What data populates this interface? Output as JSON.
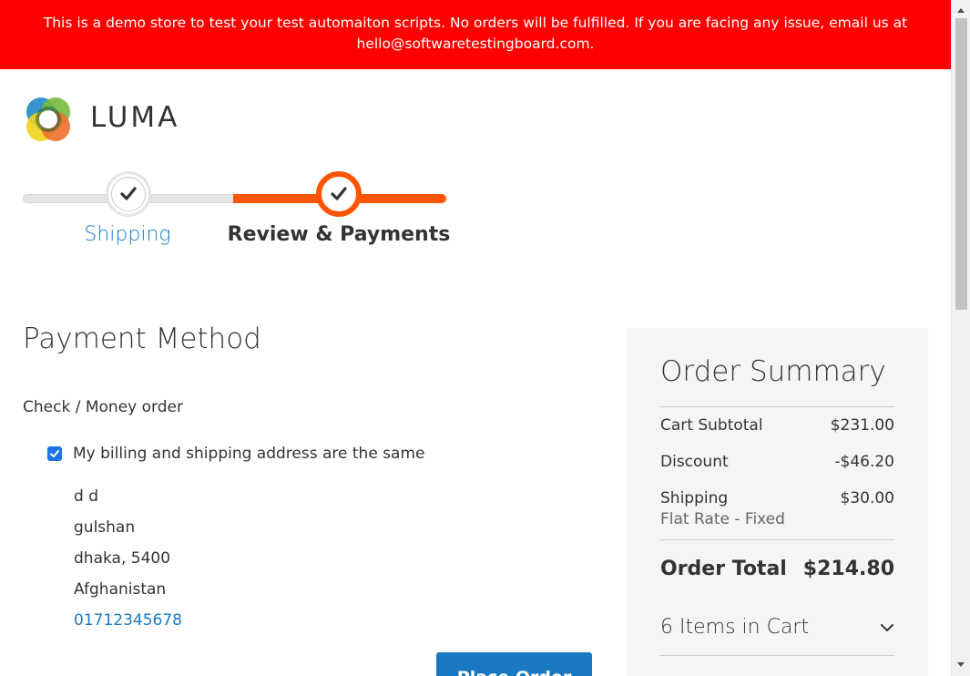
{
  "banner": {
    "text": "This is a demo store to test your test automaiton scripts. No orders will be fulfilled. If you are facing any issue, email us at hello@softwaretestingboard.com."
  },
  "logo": {
    "text": "LUMA",
    "colors": [
      "#2a8fc9",
      "#79b83f",
      "#f2d21b",
      "#ee6f2d",
      "#1a5a3a"
    ]
  },
  "progress": {
    "steps": [
      {
        "label": "Shipping",
        "state": "complete"
      },
      {
        "label": "Review & Payments",
        "state": "active"
      }
    ],
    "accent": "#ff5501"
  },
  "payment": {
    "title": "Payment Method",
    "method_label": "Check / Money order",
    "billing_same_label": "My billing and shipping address are the same",
    "billing_same_checked": true,
    "address": {
      "name": "d d",
      "street": "gulshan",
      "city_zip": "dhaka, 5400",
      "country": "Afghanistan",
      "phone": "01712345678"
    },
    "place_order_label": "Place Order"
  },
  "summary": {
    "title": "Order Summary",
    "subtotal_label": "Cart Subtotal",
    "subtotal_value": "$231.00",
    "discount_label": "Discount",
    "discount_value": "-$46.20",
    "shipping_label": "Shipping",
    "shipping_method": "Flat Rate - Fixed",
    "shipping_value": "$30.00",
    "total_label": "Order Total",
    "total_value": "$214.80",
    "items_label": "6 Items in Cart"
  },
  "colors": {
    "banner_bg": "#ff0000",
    "link": "#1979c3",
    "primary_button": "#1979c3"
  }
}
